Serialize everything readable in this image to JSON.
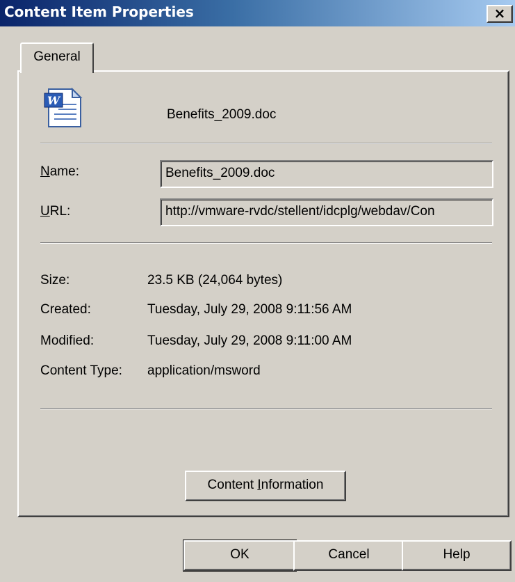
{
  "window": {
    "title": "Content Item Properties",
    "close_label": "×"
  },
  "tabs": [
    {
      "label": "General",
      "selected": true
    }
  ],
  "header": {
    "icon": "word-document-icon",
    "filename": "Benefits_2009.doc"
  },
  "fields": {
    "name": {
      "label_mnemonic": "N",
      "label_rest": "ame:",
      "value": "Benefits_2009.doc"
    },
    "url": {
      "label_mnemonic": "U",
      "label_rest": "RL:",
      "value": "http://vmware-rvdc/stellent/idcplg/webdav/Con"
    }
  },
  "info": {
    "size": {
      "label": "Size:",
      "value": "23.5 KB (24,064 bytes)"
    },
    "created": {
      "label": "Created:",
      "value": "Tuesday, July 29, 2008 9:11:56 AM"
    },
    "modified": {
      "label": "Modified:",
      "value": "Tuesday, July 29, 2008 9:11:00 AM"
    },
    "content_type": {
      "label": "Content Type:",
      "value": "application/msword"
    }
  },
  "content_info_button": {
    "pre": "Content ",
    "mnemonic": "I",
    "post": "nformation"
  },
  "buttons": {
    "ok": "OK",
    "cancel": "Cancel",
    "help": "Help"
  },
  "colors": {
    "title_gradient_start": "#0a246a",
    "title_gradient_end": "#a6caf0",
    "dialog_face": "#d4d0c8"
  }
}
